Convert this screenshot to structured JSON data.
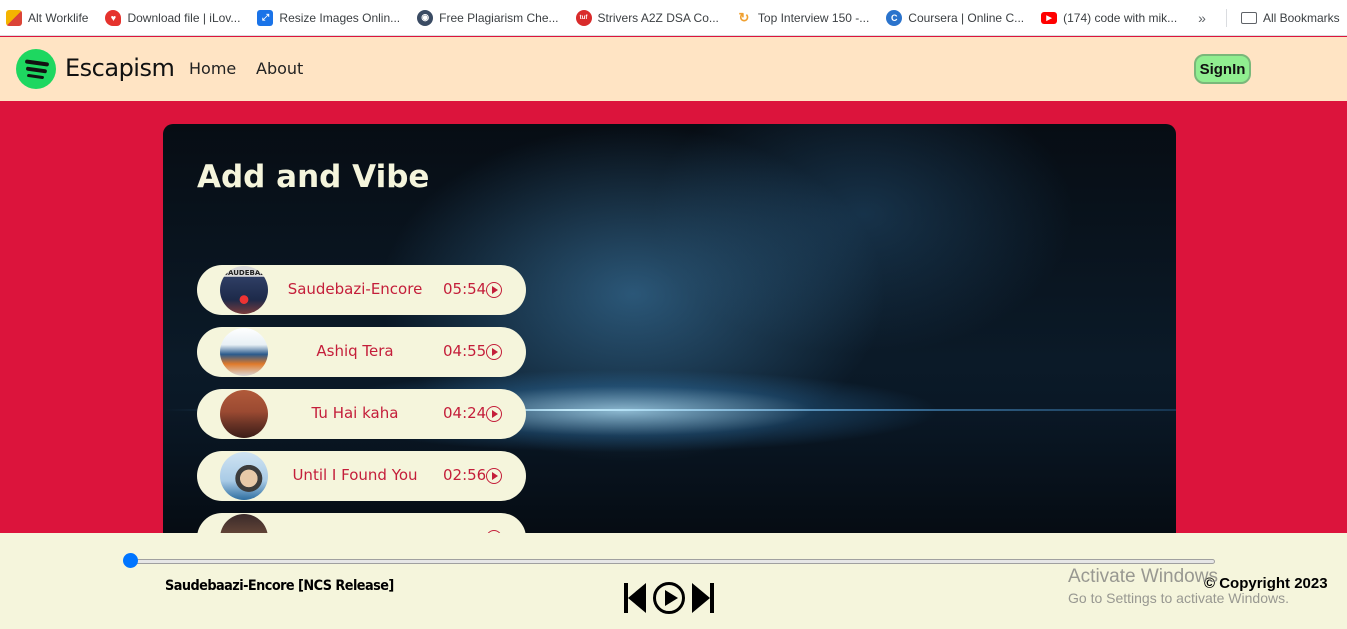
{
  "bookmarks": {
    "items": [
      {
        "label": "Alt Worklife",
        "icon": "alt-worklife-icon",
        "color": "#4a8af4"
      },
      {
        "label": "Download file | iLov...",
        "icon": "ilovepdf-heart-icon",
        "color": "#e5322d"
      },
      {
        "label": "Resize Images Onlin...",
        "icon": "resize-image-icon",
        "color": "#1a73e8"
      },
      {
        "label": "Free Plagiarism Che...",
        "icon": "plagiarism-checker-icon",
        "color": "#3a4b63"
      },
      {
        "label": "Strivers A2Z DSA Co...",
        "icon": "tuf-icon",
        "color": "#d92b2b"
      },
      {
        "label": "Top Interview 150 -...",
        "icon": "leetcode-icon",
        "color": "#f0a030"
      },
      {
        "label": "Coursera | Online C...",
        "icon": "coursera-icon",
        "color": "#2a73cc"
      },
      {
        "label": "(174) code with mik...",
        "icon": "youtube-icon",
        "color": "#ff0000"
      }
    ],
    "more": "»",
    "all_bookmarks": "All Bookmarks"
  },
  "navbar": {
    "brand": "Escapism",
    "links": [
      "Home",
      "About"
    ],
    "signin": "SignIn"
  },
  "hero": {
    "title": "Add and Vibe",
    "songs": [
      {
        "title": "Saudebazi-Encore",
        "duration": "05:54"
      },
      {
        "title": "Ashiq Tera",
        "duration": "04:55"
      },
      {
        "title": "Tu Hai kaha",
        "duration": "04:24"
      },
      {
        "title": "Until I Found You",
        "duration": "02:56"
      },
      {
        "title": "",
        "duration": ""
      }
    ]
  },
  "player": {
    "now_playing": "Saudebaazi-Encore [NCS Release]",
    "progress": 0,
    "copyright": "© Copyright 2023"
  },
  "windows_watermark": {
    "line1": "Activate Windows",
    "line2": "Go to Settings to activate Windows."
  },
  "colors": {
    "page_bg": "#dc143c",
    "navbar_bg": "#ffe4c4",
    "song_pill_bg": "#f5f5dc",
    "song_text": "#c41e3a",
    "signin_bg": "#90ee90",
    "logo_green": "#1ed760"
  }
}
